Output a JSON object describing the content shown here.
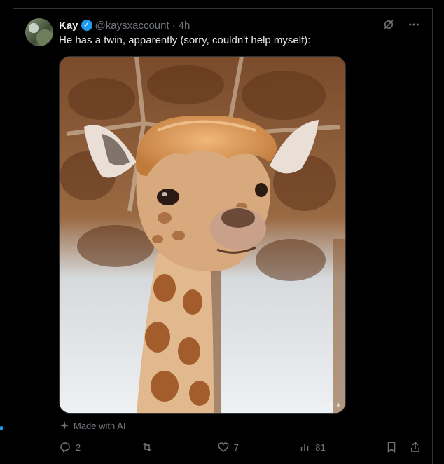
{
  "post": {
    "author_name": "Kay",
    "handle": "@kaysxaccount",
    "separator": "·",
    "time": "4h",
    "text": "He has a twin, apparently (sorry, couldn't help myself):",
    "media_watermark": "Grok",
    "made_with_label": "Made with AI",
    "stats": {
      "replies": "2",
      "reposts": "",
      "likes": "7",
      "views": "81"
    }
  },
  "colors": {
    "background": "#000000",
    "text": "#e7e9ea",
    "muted": "#71767b",
    "accent": "#1d9bf0",
    "border": "#2f3336"
  },
  "icons": {
    "verified": "verified-badge-icon",
    "grok": "grok-icon",
    "more": "more-icon",
    "reply": "reply-icon",
    "repost": "repost-icon",
    "like": "heart-icon",
    "views": "views-icon",
    "bookmark": "bookmark-icon",
    "share": "share-icon",
    "sparkle": "sparkle-icon"
  }
}
